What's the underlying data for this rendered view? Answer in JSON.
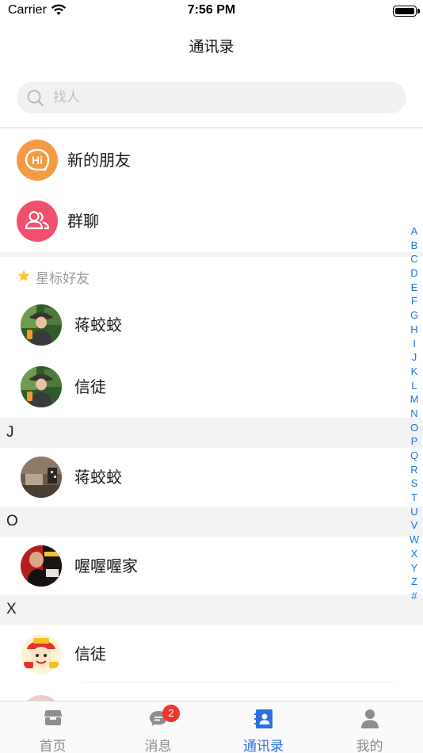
{
  "status_bar": {
    "carrier": "Carrier",
    "time": "7:56 PM"
  },
  "nav": {
    "title": "通讯录"
  },
  "search": {
    "placeholder": "找人"
  },
  "shortcuts": [
    {
      "label": "新的朋友",
      "icon": "hi-bubble-icon",
      "color": "#f29b42"
    },
    {
      "label": "群聊",
      "icon": "group-icon",
      "color": "#f1506e"
    }
  ],
  "starred": {
    "title": "星标好友",
    "contacts": [
      {
        "name": "蒋蛟蛟",
        "avatar": "photo-avatar"
      },
      {
        "name": "信徒",
        "avatar": "photo-avatar"
      }
    ]
  },
  "sections": [
    {
      "letter": "J",
      "contacts": [
        {
          "name": "蒋蛟蛟",
          "avatar": "photo-avatar"
        }
      ]
    },
    {
      "letter": "O",
      "contacts": [
        {
          "name": "喔喔喔家",
          "avatar": "photo-avatar"
        }
      ]
    },
    {
      "letter": "X",
      "contacts": [
        {
          "name": "信徒",
          "avatar": "cartoon-avatar"
        }
      ]
    }
  ],
  "index_letters": [
    "A",
    "B",
    "C",
    "D",
    "E",
    "F",
    "G",
    "H",
    "I",
    "J",
    "K",
    "L",
    "M",
    "N",
    "O",
    "P",
    "Q",
    "R",
    "S",
    "T",
    "U",
    "V",
    "W",
    "X",
    "Y",
    "Z",
    "#"
  ],
  "tabs": [
    {
      "label": "首页",
      "icon": "home-icon",
      "active": false
    },
    {
      "label": "消息",
      "icon": "chat-icon",
      "active": false,
      "badge": "2"
    },
    {
      "label": "通讯录",
      "icon": "contacts-icon",
      "active": true
    },
    {
      "label": "我的",
      "icon": "profile-icon",
      "active": false
    }
  ],
  "colors": {
    "accent": "#2b6fe0",
    "index": "#1a73e8",
    "badge": "#f0342f",
    "star": "#f7c531"
  }
}
